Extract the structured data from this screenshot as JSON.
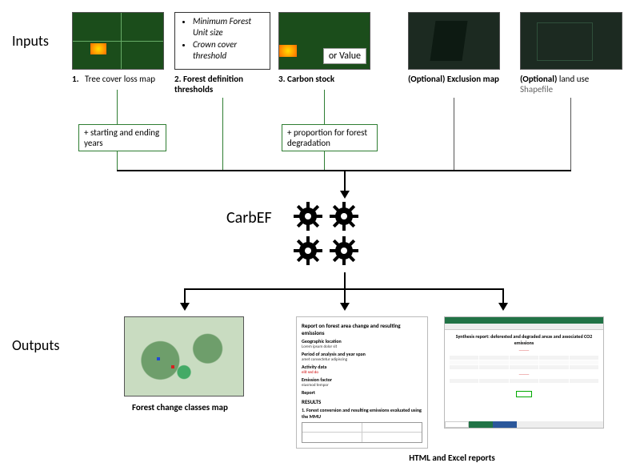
{
  "labels": {
    "inputs": "Inputs",
    "outputs": "Outputs",
    "engine": "CarbEF"
  },
  "inputs": {
    "i1": {
      "index": "1.",
      "title": "Tree cover loss map"
    },
    "i2": {
      "index": "2.",
      "title": "Forest definition thresholds",
      "params": [
        "Minimum Forest Unit size",
        "Crown cover threshold"
      ]
    },
    "i3": {
      "index": "3.",
      "title": "Carbon stock",
      "orvalue": "or Value"
    },
    "i4": {
      "title_prefix": "(Optional)",
      "title": "Exclusion map"
    },
    "i5": {
      "title_prefix": "(Optional)",
      "title": "land use",
      "subtitle": "Shapefile"
    }
  },
  "addboxes": {
    "years": "+ starting and ending years",
    "degr": "+ proportion for forest degradation"
  },
  "outputs": {
    "o1": {
      "title": "Forest change classes map"
    },
    "o2": {
      "title": "HTML and Excel reports"
    }
  },
  "report_preview": {
    "heading": "Report on forest area change and resulting emissions",
    "sec1": "Geographic location",
    "sec2": "Period of analysis and year span",
    "sec3": "Activity data",
    "sec4": "Emission factor",
    "sec5": "Report",
    "results": "RESULTS",
    "res1": "1. Forest conversion and resulting emissions evaluated using the MMU"
  },
  "excel_preview": {
    "title": "Synthesis report: deforested and degraded areas and associated CO2 emissions"
  }
}
